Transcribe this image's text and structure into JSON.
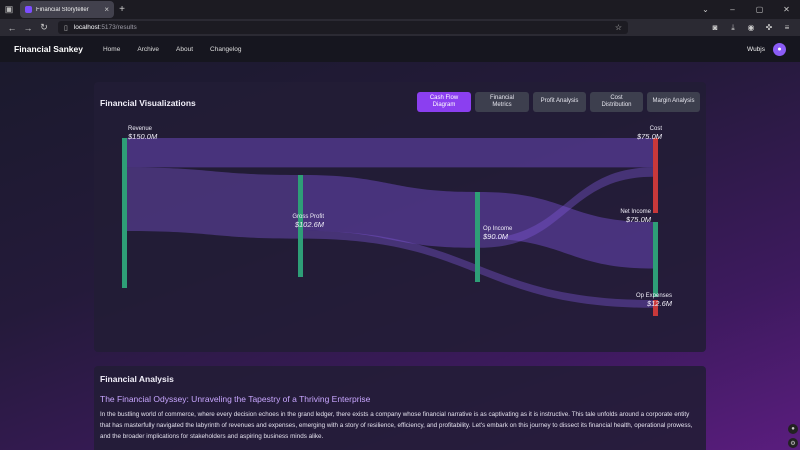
{
  "browser": {
    "tab_title": "Financial Storyteller",
    "tab_close": "×",
    "new_tab": "+",
    "url_host": "localhost",
    "url_path": ":5173/results"
  },
  "navbar": {
    "brand": "Financial Sankey",
    "links": [
      "Home",
      "Archive",
      "About",
      "Changelog"
    ],
    "user": "Wubjs"
  },
  "viz": {
    "title": "Financial Visualizations",
    "tabs": [
      {
        "label": "Cash Flow Diagram",
        "active": true
      },
      {
        "label": "Financial Metrics",
        "active": false
      },
      {
        "label": "Profit Analysis",
        "active": false
      },
      {
        "label": "Cost Distribution",
        "active": false
      },
      {
        "label": "Margin Analysis",
        "active": false
      }
    ]
  },
  "chart_data": {
    "type": "sankey",
    "nodes": [
      {
        "id": "revenue",
        "name": "Revenue",
        "value_label": "$150.0M",
        "value": 150.0,
        "color": "#2e9e77"
      },
      {
        "id": "gross",
        "name": "Gross Profit",
        "value_label": "$102.6M",
        "value": 102.6,
        "color": "#2e9e77"
      },
      {
        "id": "opinc",
        "name": "Op Income",
        "value_label": "$90.0M",
        "value": 90.0,
        "color": "#2e9e77"
      },
      {
        "id": "cost",
        "name": "Cost",
        "value_label": "$75.0M",
        "value": 75.0,
        "color": "#c8383a"
      },
      {
        "id": "netinc",
        "name": "Net Income",
        "value_label": "$75.0M",
        "value": 75.0,
        "color": "#2e9e77"
      },
      {
        "id": "opexp",
        "name": "Op Expenses",
        "value_label": "$12.6M",
        "value": 12.6,
        "color": "#c8383a"
      }
    ],
    "links": [
      {
        "source": "revenue",
        "target": "cost",
        "value": 47.4
      },
      {
        "source": "revenue",
        "target": "gross",
        "value": 102.6
      },
      {
        "source": "gross",
        "target": "opinc",
        "value": 90.0
      },
      {
        "source": "gross",
        "target": "opexp",
        "value": 12.6
      },
      {
        "source": "opinc",
        "target": "netinc",
        "value": 75.0
      },
      {
        "source": "opinc",
        "target": "cost",
        "value": 15.0
      }
    ]
  },
  "analysis": {
    "title": "Financial Analysis",
    "heading": "The Financial Odyssey: Unraveling the Tapestry of a Thriving Enterprise",
    "body": "In the bustling world of commerce, where every decision echoes in the grand ledger, there exists a company whose financial narrative is as captivating as it is instructive. This tale unfolds around a corporate entity that has masterfully navigated the labyrinth of revenues and expenses, emerging with a story of resilience, efficiency, and profitability. Let's embark on this journey to dissect its financial health, operational prowess, and the broader implications for stakeholders and aspiring business minds alike."
  }
}
